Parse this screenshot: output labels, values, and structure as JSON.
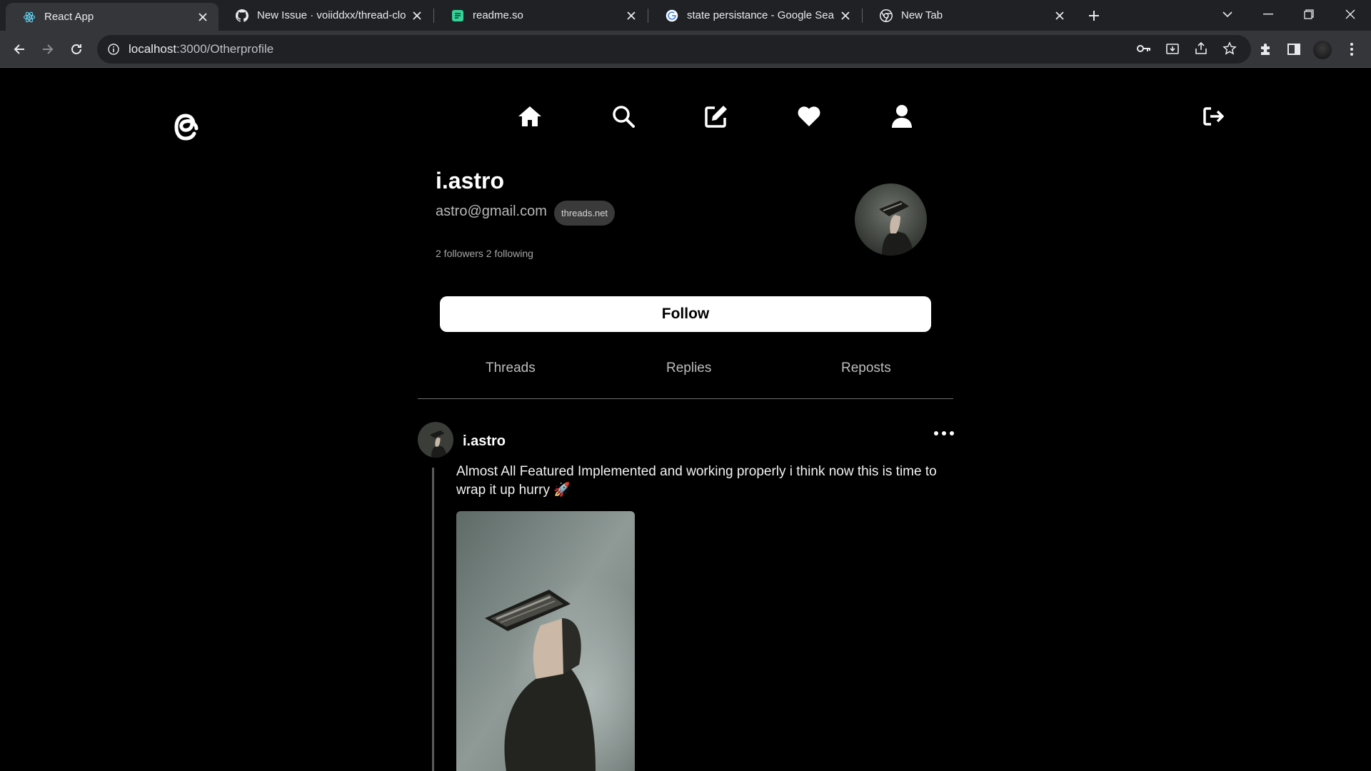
{
  "browser": {
    "tabs": [
      {
        "title": "React App",
        "icon": "react-icon"
      },
      {
        "title": "New Issue · voiiddxx/thread-clone",
        "icon": "github-icon"
      },
      {
        "title": "readme.so",
        "icon": "readme-icon"
      },
      {
        "title": "state persistance - Google Search",
        "icon": "google-icon"
      },
      {
        "title": "New Tab",
        "icon": "chrome-icon"
      }
    ],
    "url_host": "localhost",
    "url_path": ":3000/Otherprofile"
  },
  "nav": {
    "items": [
      "home-icon",
      "search-icon",
      "compose-icon",
      "heart-icon",
      "user-icon"
    ],
    "logout": "logout-icon"
  },
  "profile": {
    "username": "i.astro",
    "email": "astro@gmail.com",
    "badge": "threads.net",
    "counts": "2 followers 2 following",
    "follow_label": "Follow"
  },
  "profile_tabs": [
    "Threads",
    "Replies",
    "Reposts"
  ],
  "post": {
    "username": "i.astro",
    "text": "Almost All Featured Implemented and working properly i think now this is time to wrap it up hurry 🚀"
  },
  "colors": {
    "background": "#000000",
    "tab_strip": "#202124",
    "toolbar": "#35363a",
    "button": "#ffffff",
    "badge": "#3a3a3a"
  }
}
